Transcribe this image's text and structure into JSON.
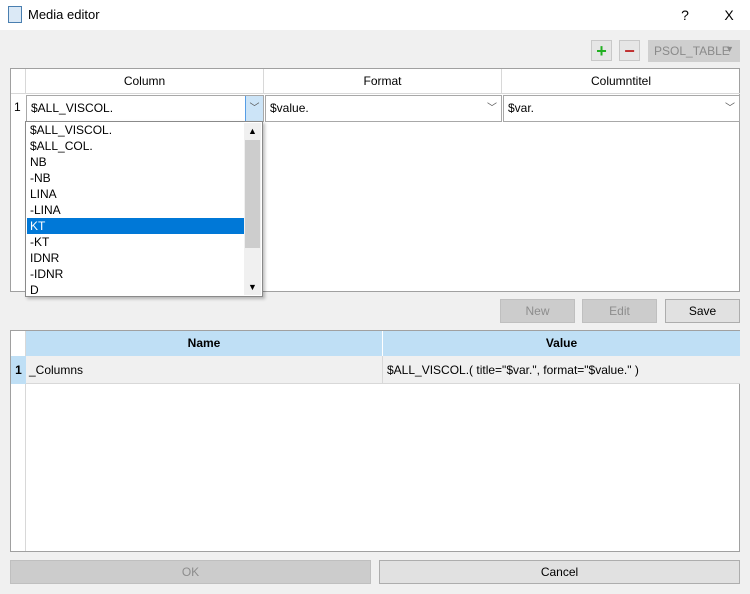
{
  "window": {
    "title": "Media editor",
    "help": "?",
    "close": "X"
  },
  "toolbar": {
    "add": "+",
    "remove": "−",
    "table_select": "PSOL_TABLE"
  },
  "top_table": {
    "headers": [
      "Column",
      "Format",
      "Columntitel"
    ],
    "rows": [
      {
        "num": "1",
        "column": "$ALL_VISCOL.",
        "format": "$value.",
        "title": "$var."
      }
    ]
  },
  "dropdown": {
    "items": [
      "$ALL_VISCOL.",
      "$ALL_COL.",
      "NB",
      "-NB",
      "LINA",
      "-LINA",
      "KT",
      "-KT",
      "IDNR",
      "-IDNR",
      "D"
    ],
    "selected": "KT"
  },
  "actions": {
    "new": "New",
    "edit": "Edit",
    "save": "Save"
  },
  "bottom_table": {
    "headers": [
      "Name",
      "Value"
    ],
    "rows": [
      {
        "num": "1",
        "name": "_Columns",
        "value": "$ALL_VISCOL.( title=\"$var.\", format=\"$value.\" )"
      }
    ]
  },
  "footer": {
    "ok": "OK",
    "cancel": "Cancel"
  }
}
